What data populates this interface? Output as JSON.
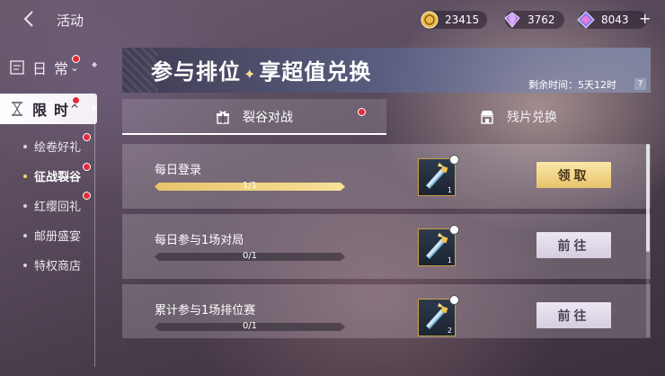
{
  "header": {
    "title": "活动",
    "currencies": [
      {
        "icon": "gold-coin-icon",
        "amount": "23415"
      },
      {
        "icon": "purple-gem-icon",
        "amount": "3762"
      },
      {
        "icon": "crystal-icon",
        "amount": "8043"
      }
    ],
    "add_label": "+"
  },
  "sidebar": {
    "daily_label": "日常",
    "limited_label": "限时",
    "items": [
      {
        "label": "绘卷好礼",
        "badge": true
      },
      {
        "label": "征战裂谷",
        "badge": true,
        "active": true
      },
      {
        "label": "红缨回礼",
        "badge": true
      },
      {
        "label": "邮册盛宴",
        "badge": false
      },
      {
        "label": "特权商店",
        "badge": false
      }
    ]
  },
  "banner": {
    "title_part1": "参与排位",
    "title_star": "✦",
    "title_part2": "享超值兑换",
    "remaining": "剩余时间：5天12时",
    "help": "?"
  },
  "tabs": [
    {
      "label": "裂谷对战",
      "icon": "gift-icon",
      "active": true,
      "badge": true
    },
    {
      "label": "残片兑换",
      "icon": "shop-icon",
      "active": false,
      "badge": false
    }
  ],
  "tasks": [
    {
      "name": "每日登录",
      "progress_text": "1/1",
      "progress": 1.0,
      "reward_count": "1",
      "button": "领取",
      "button_type": "claim"
    },
    {
      "name": "每日参与1场对局",
      "progress_text": "0/1",
      "progress": 0.0,
      "reward_count": "1",
      "button": "前往",
      "button_type": "go"
    },
    {
      "name": "累计参与1场排位赛",
      "progress_text": "0/1",
      "progress": 0.0,
      "reward_count": "2",
      "button": "前往",
      "button_type": "go"
    }
  ],
  "colors": {
    "accent_gold": "#f7d273",
    "badge_red": "#e52a3a"
  }
}
